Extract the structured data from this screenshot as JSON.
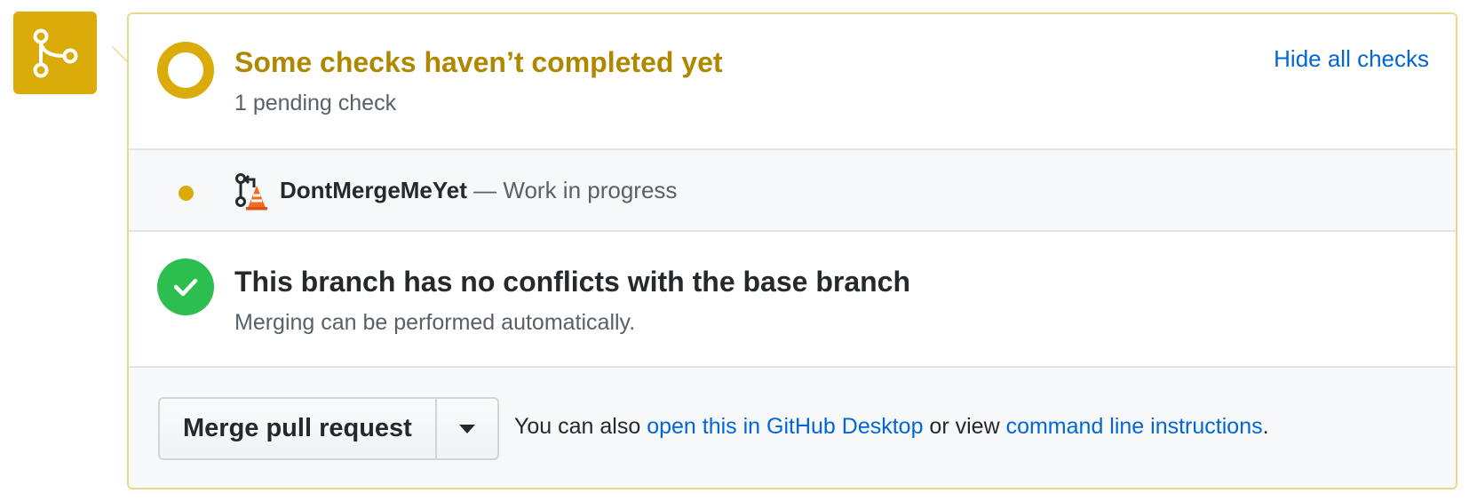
{
  "colors": {
    "pending": "#dbab09",
    "pending_text": "#b08800",
    "success": "#2cbe4e",
    "link": "#0366d6",
    "panel_border": "#ebd98b"
  },
  "icons": {
    "timeline": "git-merge-icon",
    "status": "pending-ring-icon",
    "check_status": "pending-dot-icon",
    "check_app": "dont-merge-me-yet-app-icon",
    "conflict_status": "check-icon",
    "dropdown": "triangle-down-icon"
  },
  "status": {
    "title": "Some checks haven’t completed yet",
    "subtitle": "1 pending check",
    "toggle_link": "Hide all checks"
  },
  "checks": [
    {
      "name": "DontMergeMeYet",
      "separator": " — ",
      "description": "Work in progress",
      "state": "pending"
    }
  ],
  "conflicts": {
    "title": "This branch has no conflicts with the base branch",
    "subtitle": "Merging can be performed automatically."
  },
  "merge": {
    "button_label": "Merge pull request",
    "note_prefix": "You can also ",
    "desktop_link": "open this in GitHub Desktop",
    "note_middle": " or view ",
    "cli_link": "command line instructions",
    "note_suffix": "."
  }
}
